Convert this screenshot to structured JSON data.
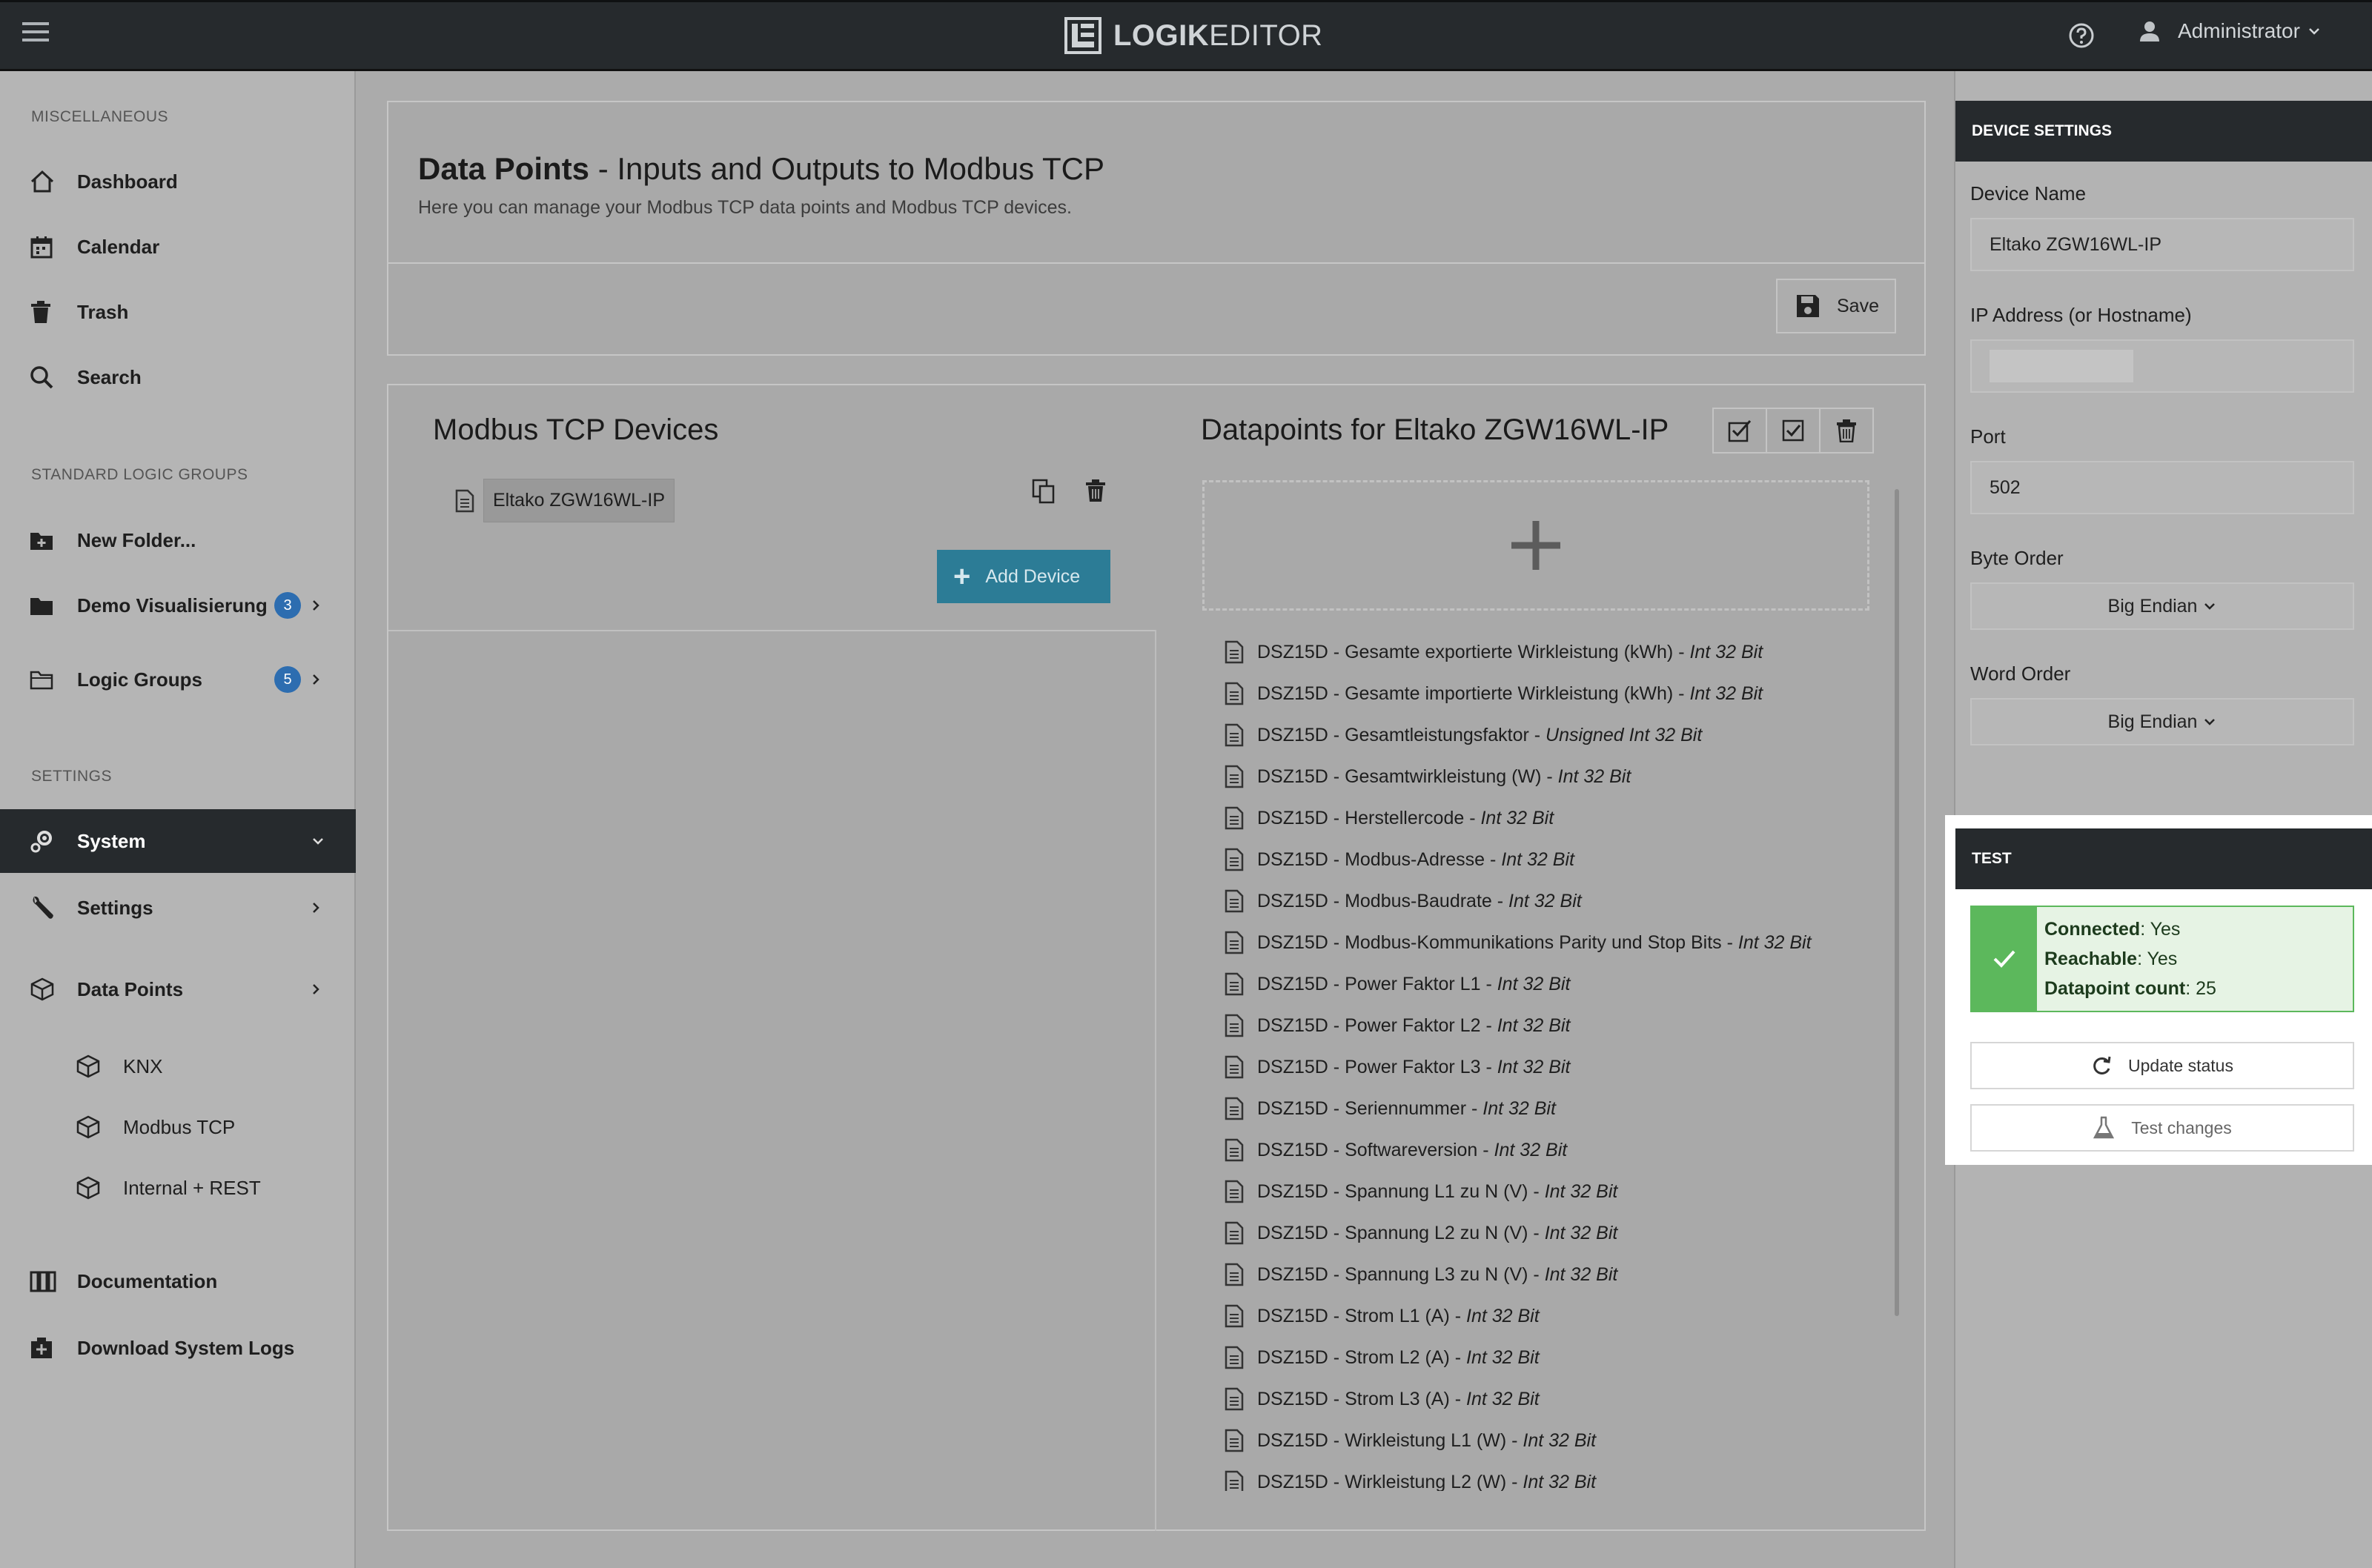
{
  "topbar": {
    "logo_bold": "LOGIK",
    "logo_light": "EDITOR",
    "user": "Administrator"
  },
  "sidebar": {
    "sections": [
      "MISCELLANEOUS",
      "STANDARD LOGIC GROUPS",
      "SETTINGS"
    ],
    "misc_items": [
      {
        "label": "Dashboard",
        "icon": "home-icon"
      },
      {
        "label": "Calendar",
        "icon": "calendar-icon"
      },
      {
        "label": "Trash",
        "icon": "trash-icon"
      },
      {
        "label": "Search",
        "icon": "search-icon"
      }
    ],
    "logic_items": [
      {
        "label": "New Folder...",
        "icon": "folder-plus-icon"
      },
      {
        "label": "Demo Visualisierung",
        "icon": "folder-icon",
        "badge": "3"
      },
      {
        "label": "Logic Groups",
        "icon": "folder-open-icon",
        "badge": "5"
      }
    ],
    "settings_items": [
      {
        "label": "System",
        "icon": "gears-icon",
        "active": true
      },
      {
        "label": "Settings",
        "icon": "wrench-icon"
      },
      {
        "label": "Data Points",
        "icon": "cube-icon"
      }
    ],
    "datapoint_sub": [
      {
        "label": "KNX"
      },
      {
        "label": "Modbus TCP"
      },
      {
        "label": "Internal + REST"
      }
    ],
    "bottom_items": [
      {
        "label": "Documentation",
        "icon": "book-icon"
      },
      {
        "label": "Download System Logs",
        "icon": "download-icon"
      }
    ]
  },
  "page": {
    "title_bold": "Data Points",
    "title_rest": " - Inputs and Outputs to Modbus TCP",
    "subtitle": "Here you can manage your Modbus TCP data points and Modbus TCP devices.",
    "save_label": "Save"
  },
  "devices": {
    "title": "Modbus TCP Devices",
    "list": [
      "Eltako ZGW16WL-IP"
    ],
    "add_label": "Add Device"
  },
  "datapoints": {
    "title": "Datapoints for Eltako ZGW16WL-IP",
    "items": [
      {
        "name": "DSZ15D - Gesamte exportierte Wirkleistung (kWh)",
        "type": "Int 32 Bit"
      },
      {
        "name": "DSZ15D - Gesamte importierte Wirkleistung (kWh)",
        "type": "Int 32 Bit"
      },
      {
        "name": "DSZ15D - Gesamtleistungsfaktor",
        "type": "Unsigned Int 32 Bit"
      },
      {
        "name": "DSZ15D - Gesamtwirkleistung (W)",
        "type": "Int 32 Bit"
      },
      {
        "name": "DSZ15D - Herstellercode",
        "type": "Int 32 Bit"
      },
      {
        "name": "DSZ15D - Modbus-Adresse",
        "type": "Int 32 Bit"
      },
      {
        "name": "DSZ15D - Modbus-Baudrate",
        "type": "Int 32 Bit"
      },
      {
        "name": "DSZ15D - Modbus-Kommunikations Parity und Stop Bits",
        "type": "Int 32 Bit"
      },
      {
        "name": "DSZ15D - Power Faktor L1",
        "type": "Int 32 Bit"
      },
      {
        "name": "DSZ15D - Power Faktor L2",
        "type": "Int 32 Bit"
      },
      {
        "name": "DSZ15D - Power Faktor L3",
        "type": "Int 32 Bit"
      },
      {
        "name": "DSZ15D - Seriennummer",
        "type": "Int 32 Bit"
      },
      {
        "name": "DSZ15D - Softwareversion",
        "type": "Int 32 Bit"
      },
      {
        "name": "DSZ15D - Spannung L1 zu N (V)",
        "type": "Int 32 Bit"
      },
      {
        "name": "DSZ15D - Spannung L2 zu N (V)",
        "type": "Int 32 Bit"
      },
      {
        "name": "DSZ15D - Spannung L3 zu N (V)",
        "type": "Int 32 Bit"
      },
      {
        "name": "DSZ15D - Strom L1 (A)",
        "type": "Int 32 Bit"
      },
      {
        "name": "DSZ15D - Strom L2 (A)",
        "type": "Int 32 Bit"
      },
      {
        "name": "DSZ15D - Strom L3 (A)",
        "type": "Int 32 Bit"
      },
      {
        "name": "DSZ15D - Wirkleistung L1 (W)",
        "type": "Int 32 Bit"
      },
      {
        "name": "DSZ15D - Wirkleistung L2 (W)",
        "type": "Int 32 Bit"
      }
    ]
  },
  "device_settings": {
    "header": "DEVICE SETTINGS",
    "device_name_label": "Device Name",
    "device_name_value": "Eltako ZGW16WL-IP",
    "ip_label": "IP Address (or Hostname)",
    "port_label": "Port",
    "port_value": "502",
    "byte_order_label": "Byte Order",
    "byte_order_value": "Big Endian",
    "word_order_label": "Word Order",
    "word_order_value": "Big Endian"
  },
  "test": {
    "header": "TEST",
    "connected_label": "Connected",
    "connected_value": ": Yes",
    "reachable_label": "Reachable",
    "reachable_value": ": Yes",
    "count_label": "Datapoint count",
    "count_value": ": 25",
    "update_label": "Update status",
    "test_label": "Test changes"
  },
  "colors": {
    "topbar": "#262a2d",
    "accent_button": "#2c7c96",
    "badge": "#2d6db0",
    "success": "#5cb85c"
  }
}
